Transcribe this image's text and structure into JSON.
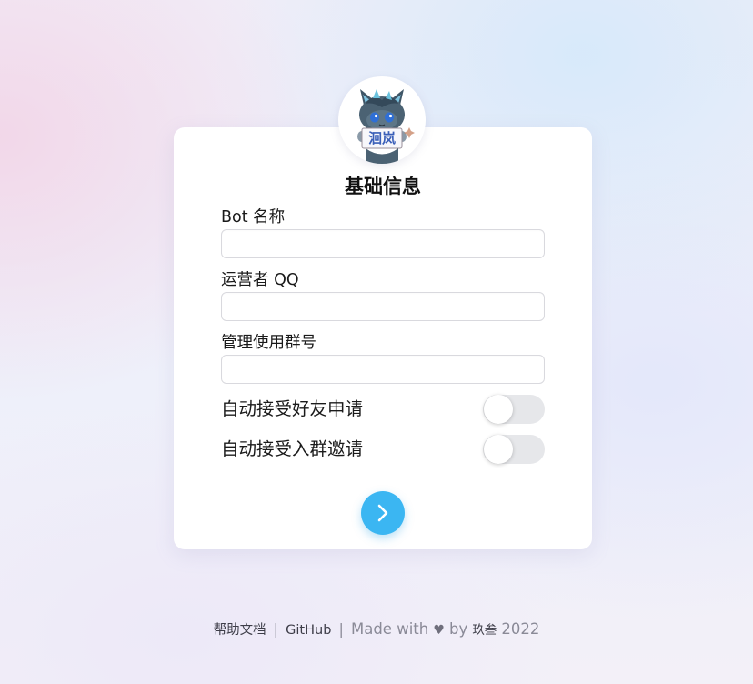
{
  "avatar": {
    "sign_text": "洄岚"
  },
  "form": {
    "title": "基础信息",
    "fields": [
      {
        "label": "Bot 名称",
        "value": "",
        "placeholder": ""
      },
      {
        "label": "运营者 QQ",
        "value": "",
        "placeholder": ""
      },
      {
        "label": "管理使用群号",
        "value": "",
        "placeholder": ""
      }
    ],
    "toggles": [
      {
        "label": "自动接受好友申请",
        "state": "off"
      },
      {
        "label": "自动接受入群邀请",
        "state": "off"
      }
    ],
    "next_icon": "chevron-right-icon"
  },
  "footer": {
    "help_link": "帮助文档",
    "separator": "|",
    "github_link": "GitHub",
    "made_with": "Made with",
    "heart": "♥",
    "by": "by",
    "author": "玖叁",
    "year": "2022"
  },
  "colors": {
    "accent": "#3bb6f2",
    "toggle_track": "#e6e7ea",
    "input_border": "#d9d9de"
  }
}
